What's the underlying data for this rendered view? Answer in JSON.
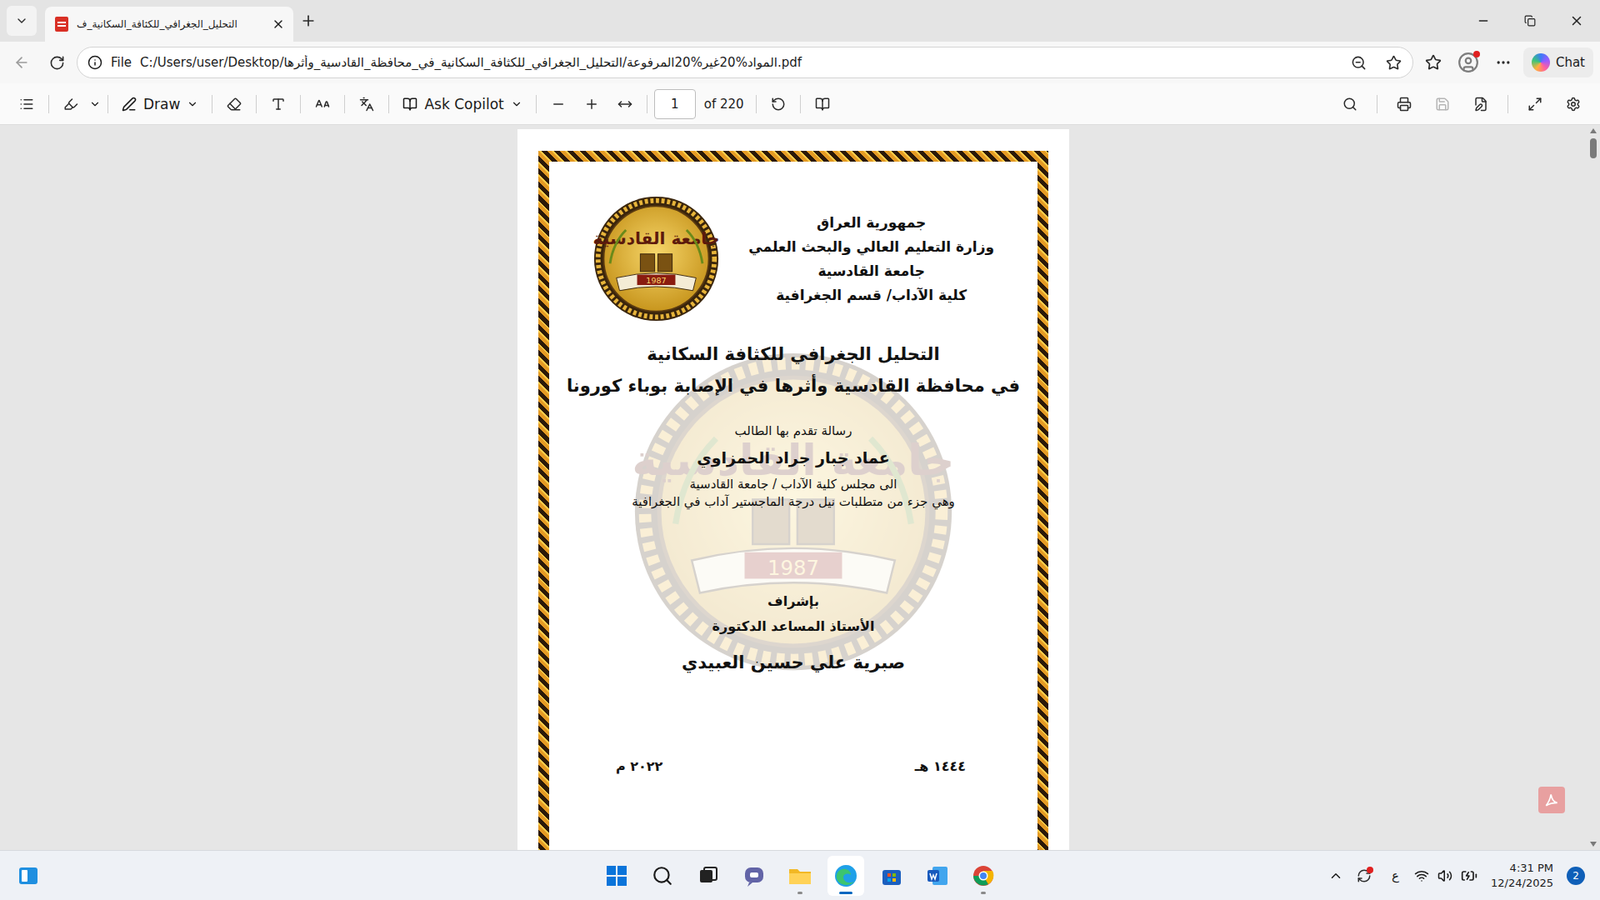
{
  "tabs": [
    {
      "label": "التحليل_الجغرافي_للكثافة_السكانية_ف",
      "selected": true
    }
  ],
  "address_bar": {
    "scheme": "File",
    "url": "C:/Users/user/Desktop/المواد%20غير%20المرفوعة/التحليل_الجغرافي_للكثافة_السكانية_في_محافظة_القادسية_وأثرها.pdf"
  },
  "chat_button": "Chat",
  "pdf_toolbar": {
    "draw": "Draw",
    "copilot": "Ask Copilot",
    "page": "1",
    "page_count": "of 220",
    "save_disabled": true
  },
  "document": {
    "header": [
      "جمهورية العراق",
      "وزارة التعليم العالي والبحث العلمي",
      "جامعة القادسية",
      "كلية الآداب/ قسم الجغرافية"
    ],
    "logo": {
      "name": "جامعة القادسية",
      "year": "1987"
    },
    "title": [
      "التحليل الجغرافي للكثافة السكانية",
      "في محافظة القادسية وأثرها في الإصابة بوباء كورونا"
    ],
    "submitted_by": "رسالة تقدم بها الطالب",
    "student": "عماد جبار جراد الحمزاوي",
    "submission": [
      "الى مجلس كلية الآداب / جامعة القادسية",
      "وهي جزء من متطلبات نيل درجة الماجستير آداب في الجغرافية"
    ],
    "supervision": "بإشراف",
    "supervisor_rank": "الأستاذ المساعد الدكتورة",
    "supervisor": "صبرية علي حسين العبيدي",
    "hijri_year": "١٤٤٤ هـ",
    "gregorian_year": "٢٠٢٢ م"
  },
  "taskbar": {
    "language": "ع",
    "time": "4:31 PM",
    "date": "12/24/2025",
    "notifications": "2"
  }
}
